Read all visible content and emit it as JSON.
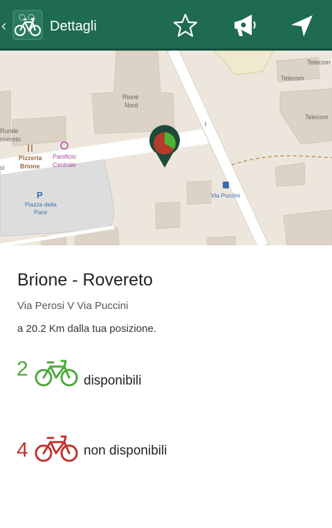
{
  "header": {
    "title": "Dettagli",
    "back_glyph": "‹",
    "icons": [
      "bike-app-icon",
      "star-icon",
      "megaphone-icon",
      "navigate-icon"
    ],
    "bar_color": "#1e6a52"
  },
  "map": {
    "labels": {
      "telecom1": "Telecom",
      "telecom2": "Telecom",
      "telecom3": "Telecom",
      "rione1": "Rione",
      "rione2": "Nord",
      "pizzeria1": "Pizzeria",
      "pizzeria2": "Brione",
      "panificio1": "Panificio",
      "panificio2": "Centrale",
      "piazza1": "Piazza della",
      "piazza2": "Pace",
      "parking": "P",
      "bus_stop": "Via Puccini",
      "rurale": "Rurale",
      "rovereto": "overeto",
      "edge_si": "si",
      "road_mark": "t"
    },
    "marker": {
      "available_share": 0.333,
      "colors": {
        "available": "#4cb535",
        "unavailable": "#b53a28",
        "pin": "#1d4a3a"
      }
    }
  },
  "station": {
    "name": "Brione - Rovereto",
    "address": "Via Perosi V Via Puccini",
    "distance": "a 20.2 Km dalla tua posizione.",
    "available": {
      "count": "2",
      "label": "disponibili",
      "color": "#4aa83a"
    },
    "unavailable": {
      "count": "4",
      "label": "non disponibili",
      "color": "#c0312a"
    }
  }
}
